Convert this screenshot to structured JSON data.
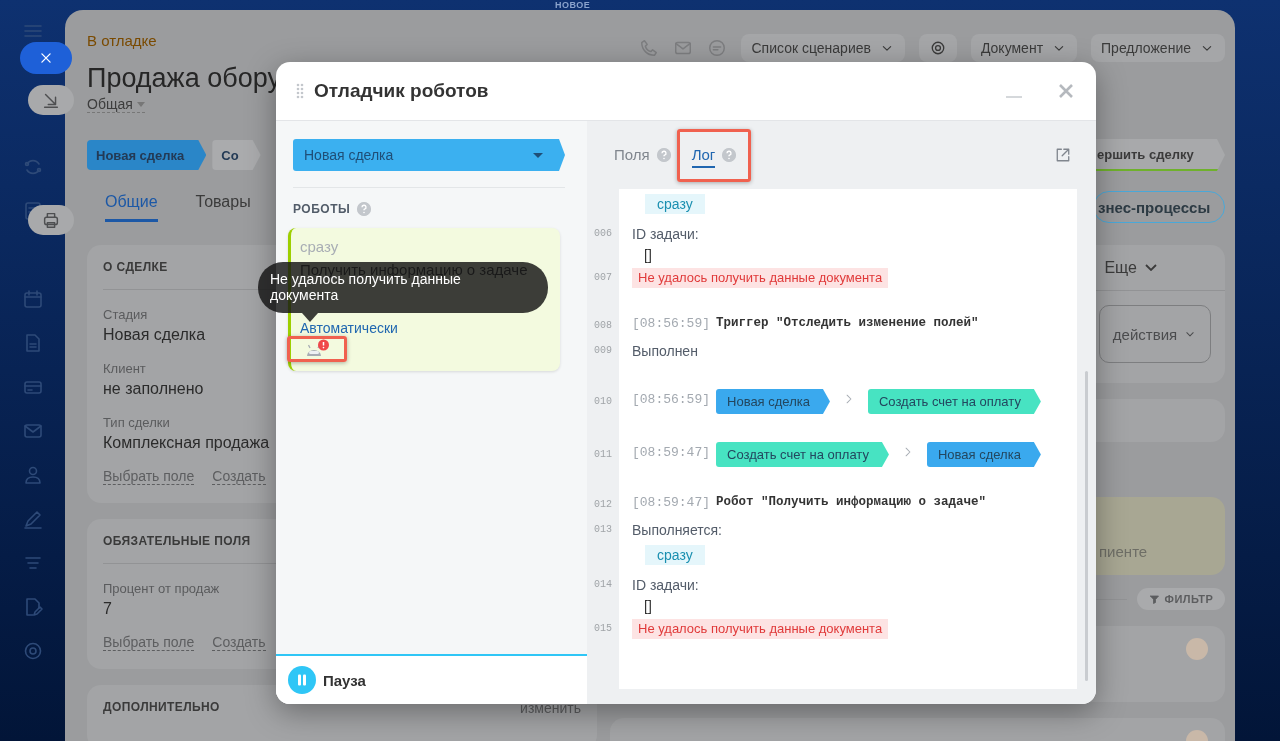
{
  "background": {
    "top_label": "НОВОЕ",
    "status": "В отладке",
    "title": "Продажа обору",
    "category": "Общая",
    "toolbar": {
      "scenarios": "Список сценариев",
      "document": "Документ",
      "offer": "Предложение"
    },
    "stages": [
      {
        "label": "Новая сделка",
        "color": "#2a86c8"
      },
      {
        "label": "Со",
        "color": "#aaabad"
      }
    ],
    "finish_stage": "ершить сделку",
    "tabs": [
      {
        "label": "Общие",
        "selected": true
      },
      {
        "label": "Товары",
        "selected": false
      }
    ],
    "bp_button": "знес-процессы",
    "cards": [
      {
        "title": "О СДЕЛКЕ",
        "fields": [
          {
            "label": "Стадия",
            "value": "Новая сделка"
          },
          {
            "label": "Клиент",
            "value": "не заполнено"
          },
          {
            "label": "Тип сделки",
            "value": "Комплексная продажа"
          }
        ],
        "links": [
          "Выбрать поле",
          "Создать"
        ]
      },
      {
        "title": "ОБЯЗАТЕЛЬНЫЕ ПОЛЯ",
        "fields": [
          {
            "label": "Процент от продаж",
            "value": "7"
          }
        ],
        "links": [
          "Выбрать поле",
          "Создать"
        ]
      },
      {
        "title": "ДОПОЛНИТЕЛЬНО",
        "action": "изменить"
      }
    ],
    "side": {
      "more": "Еще",
      "actions": "действия",
      "note": "пиенте",
      "filter": "ФИЛЬТР"
    }
  },
  "debugger": {
    "title": "Отладчик роботов",
    "stage_select": "Новая сделка",
    "robots_heading": "РОБОТЫ",
    "robot": {
      "timing": "сразу",
      "name": "Получить информацию о задаче",
      "responsible": "Автоматически",
      "error": true,
      "icon_highlighted": true
    },
    "tooltip": "Не удалось получить данные документа",
    "pause": "Пауза",
    "tabs": [
      {
        "label": "Поля",
        "selected": false,
        "highlighted": false
      },
      {
        "label": "Лог",
        "selected": true,
        "highlighted": true
      }
    ],
    "log": [
      {
        "kind": "tag",
        "text": "сразу"
      },
      {
        "kind": "text",
        "number": "006",
        "text": "ID задачи:"
      },
      {
        "kind": "bracket",
        "text": "[]"
      },
      {
        "kind": "error",
        "number": "007",
        "text": "Не удалось получить данные документа"
      },
      {
        "kind": "event",
        "number": "008",
        "time": "[08:56:59]",
        "text": "Триггер \"Отследить изменение полей\""
      },
      {
        "kind": "text",
        "number": "009",
        "text": "Выполнен"
      },
      {
        "kind": "stages",
        "number": "010",
        "time": "[08:56:59]",
        "from": {
          "label": "Новая сделка",
          "color": "#3aa9ee"
        },
        "to": {
          "label": "Создать счет на оплату",
          "color": "#47e3c2"
        }
      },
      {
        "kind": "stages",
        "number": "011",
        "time": "[08:59:47]",
        "from": {
          "label": "Создать счет на оплату",
          "color": "#47e3c2"
        },
        "to": {
          "label": "Новая сделка",
          "color": "#3aa9ee"
        }
      },
      {
        "kind": "event",
        "number": "012",
        "time": "[08:59:47]",
        "text": "Робот \"Получить информацию о задаче\""
      },
      {
        "kind": "text",
        "number": "013",
        "text": "Выполняется:"
      },
      {
        "kind": "tag",
        "text": "сразу"
      },
      {
        "kind": "text",
        "number": "014",
        "text": "ID задачи:"
      },
      {
        "kind": "bracket",
        "text": "[]"
      },
      {
        "kind": "error",
        "number": "015",
        "text": "Не удалось получить данные документа"
      }
    ]
  }
}
